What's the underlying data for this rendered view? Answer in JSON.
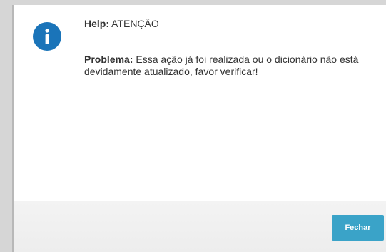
{
  "dialog": {
    "icon": "info-icon",
    "help_label": "Help:",
    "help_text": "ATENÇÃO",
    "problem_label": "Problema:",
    "problem_text": "Essa ação já foi realizada ou o dicionário não está devidamente atualizado, favor verificar!",
    "close_label": "Fechar"
  },
  "colors": {
    "icon_background": "#1a74b9",
    "button_background": "#3aa3c8",
    "text": "#333333"
  }
}
